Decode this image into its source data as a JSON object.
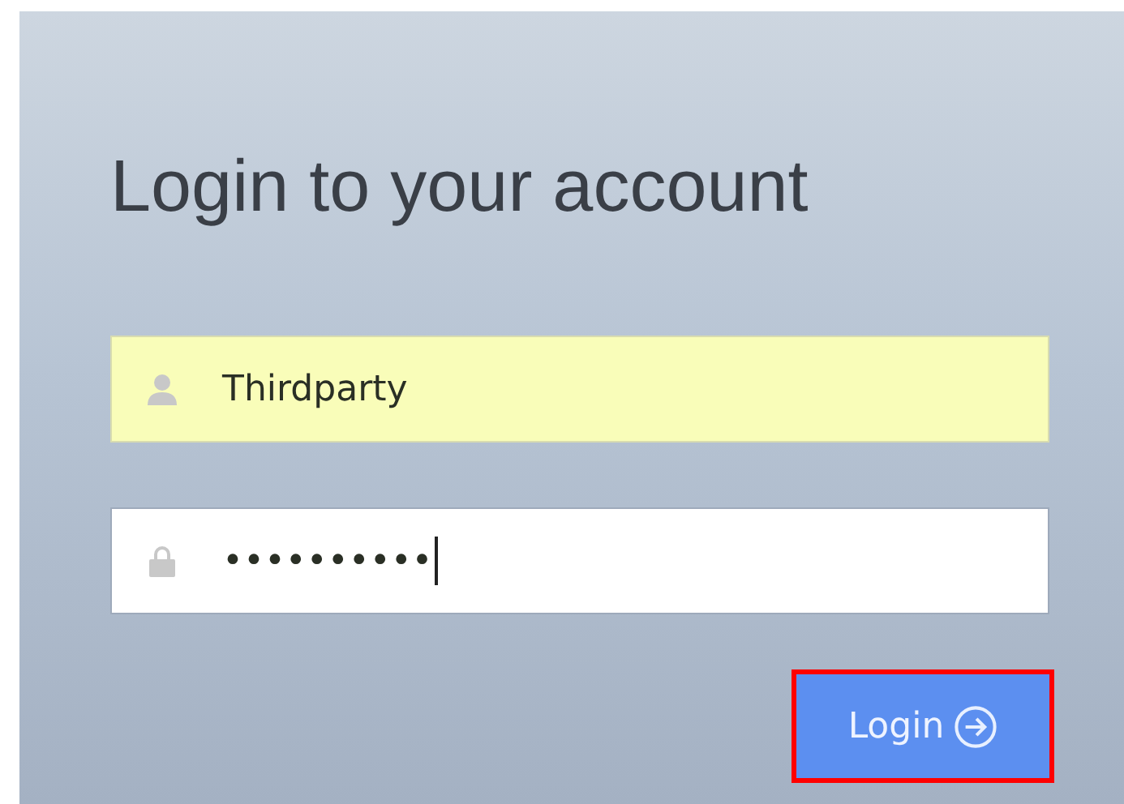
{
  "title": "Login to your account",
  "fields": [
    {
      "kind": "username",
      "value": "Thirdparty",
      "autofilled": true,
      "focused": false
    },
    {
      "kind": "password",
      "value": "••••••••••",
      "autofilled": false,
      "focused": true
    }
  ],
  "button": {
    "label": "Login",
    "highlighted": true
  }
}
